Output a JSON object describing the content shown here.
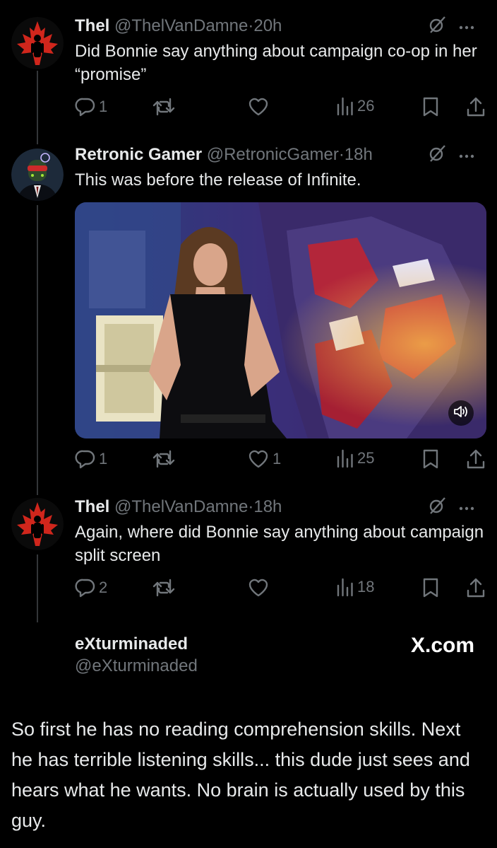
{
  "tweets": [
    {
      "name": "Thel",
      "handle": "@ThelVanDamne",
      "dot": "·",
      "time": "20h",
      "text": "Did Bonnie say anything about campaign co-op in her “promise”",
      "replies": "1",
      "retweets": "",
      "likes": "",
      "views": "26"
    },
    {
      "name": "Retronic Gamer",
      "handle": "@RetronicGamer",
      "dot": "·",
      "time": "18h",
      "text": "This was before the release of Infinite.",
      "replies": "1",
      "retweets": "",
      "likes": "1",
      "views": "25"
    },
    {
      "name": "Thel",
      "handle": "@ThelVanDamne",
      "dot": "·",
      "time": "18h",
      "text": "Again, where did Bonnie say anything about campaign split screen",
      "replies": "2",
      "retweets": "",
      "likes": "",
      "views": "18"
    }
  ],
  "byline": {
    "name": "eXturminaded",
    "handle": "@eXturminaded",
    "site": "X.com"
  },
  "caption": "So first he has no reading comprehension skills. Next he has terrible listening skills... this dude just sees and hears what he wants. No brain is actually used by this guy.",
  "icons": {
    "reply": "reply-icon",
    "retweet": "retweet-icon",
    "like": "heart-icon",
    "views": "views-icon",
    "bookmark": "bookmark-icon",
    "share": "share-icon",
    "grok": "grok-icon",
    "more": "more-icon",
    "sound": "sound-icon"
  },
  "colors": {
    "background": "#000000",
    "text": "#e7e9ea",
    "secondary": "#71767b",
    "maple_red": "#d0261c"
  }
}
